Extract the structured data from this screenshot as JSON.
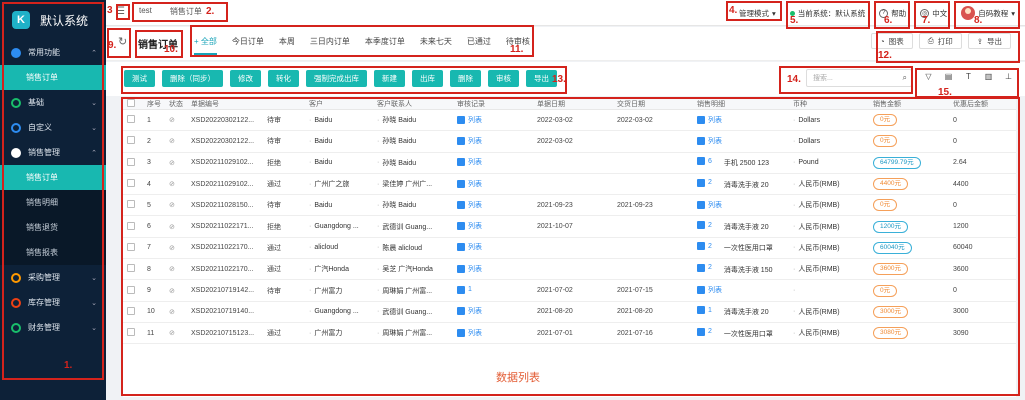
{
  "sidebar": {
    "title": "默认系统",
    "groups": [
      {
        "label": "常用功能",
        "color": "#2d8cf0",
        "items": [
          "销售订单"
        ]
      },
      {
        "label": "基础",
        "color": "#19be6b",
        "items": []
      },
      {
        "label": "自定义",
        "color": "#2d8cf0",
        "items": []
      },
      {
        "label": "销售管理",
        "color": "#ffffff",
        "items": [
          "销售订单",
          "销售明细",
          "销售退货",
          "销售报表"
        ]
      },
      {
        "label": "采购管理",
        "color": "#ff9900",
        "items": []
      },
      {
        "label": "库存管理",
        "color": "#ed4014",
        "items": []
      },
      {
        "label": "财务管理",
        "color": "#19be6b",
        "items": []
      }
    ]
  },
  "topbar": {
    "breadcrumb": [
      "test",
      "销售订单"
    ],
    "mode": "管理模式",
    "current_system": "当前系统：默认系统",
    "help": "帮助",
    "lang": "中文",
    "user": "自码教程"
  },
  "page": {
    "title": "销售订单",
    "tabs": [
      "全部",
      "今日订单",
      "本周",
      "三日内订单",
      "本季度订单",
      "未来七天",
      "已通过",
      "待审核"
    ],
    "right_buttons": [
      "图表",
      "打印",
      "导出"
    ]
  },
  "toolbar": {
    "buttons": [
      "测试",
      "删除（同步）",
      "修改",
      "转化",
      "强制完成出库",
      "新建",
      "出库",
      "删除",
      "审核",
      "导出"
    ],
    "search_placeholder": "搜索..."
  },
  "table": {
    "headers": [
      "序号",
      "状态",
      "单据编号",
      "",
      "客户",
      "客户联系人",
      "审核记录",
      "单据日期",
      "交货日期",
      "销售明细",
      "币种",
      "销售金额",
      "优惠后金额"
    ],
    "rows": [
      [
        "1",
        "",
        "XSD20220302122...",
        "待审",
        "Baidu",
        "孙晓 Baidu",
        "列表",
        "2022-03-02",
        "2022-03-02",
        "列表",
        "Dollars",
        "0元",
        "0"
      ],
      [
        "2",
        "",
        "XSD20220302122...",
        "待审",
        "Baidu",
        "孙晓 Baidu",
        "列表",
        "2022-03-02",
        "",
        "列表",
        "Dollars",
        "0元",
        "0"
      ],
      [
        "3",
        "",
        "XSD20211029102...",
        "拒绝",
        "Baidu",
        "孙晓 Baidu",
        "列表",
        "",
        "",
        "6",
        "Pound",
        "64799.79元",
        "2.64"
      ],
      [
        "4",
        "",
        "XSD20211029102...",
        "通过",
        "广州广之旅",
        "梁佳婷 广州广...",
        "列表",
        "",
        "",
        "2",
        "人民币(RMB)",
        "4400元",
        "4400"
      ],
      [
        "5",
        "",
        "XSD20211028150...",
        "待审",
        "Baidu",
        "孙晓 Baidu",
        "列表",
        "2021-09-23",
        "2021-09-23",
        "列表",
        "人民币(RMB)",
        "0元",
        "0"
      ],
      [
        "6",
        "",
        "XSD20211022171...",
        "拒绝",
        "Guangdong ...",
        "武德训 Guang...",
        "列表",
        "2021-10-07",
        "",
        "2",
        "人民币(RMB)",
        "1200元",
        "1200"
      ],
      [
        "7",
        "",
        "XSD20211022170...",
        "通过",
        "alicloud",
        "陈晨 alicloud",
        "列表",
        "",
        "",
        "2",
        "人民币(RMB)",
        "60040元",
        "60040"
      ],
      [
        "8",
        "",
        "XSD20211022170...",
        "通过",
        "广汽Honda",
        "吴芝 广汽Honda",
        "列表",
        "",
        "",
        "2",
        "人民币(RMB)",
        "3600元",
        "3600"
      ],
      [
        "9",
        "",
        "XSD20210719142...",
        "待审",
        "广州富力",
        "周琳娟 广州富...",
        "1",
        "2021-07-02",
        "2021-07-15",
        "列表",
        "",
        "0元",
        "0"
      ],
      [
        "10",
        "",
        "XSD20210719140...",
        "",
        "Guangdong ...",
        "武德训 Guang...",
        "列表",
        "2021-08-20",
        "2021-08-20",
        "1",
        "人民币(RMB)",
        "3000元",
        "3000"
      ],
      [
        "11",
        "",
        "XSD20210715123...",
        "通过",
        "广州富力",
        "周琳娟 广州富...",
        "列表",
        "2021-07-01",
        "2021-07-16",
        "2",
        "人民币(RMB)",
        "3080元",
        "3090"
      ]
    ],
    "detail_text": [
      "",
      "",
      "手机 2500 123",
      "消毒洗手液 20",
      "",
      "消毒洗手液 20",
      "一次性医用口罩",
      "消毒洗手液 150",
      "",
      "消毒洗手液 20",
      "一次性医用口罩"
    ],
    "blue_pills": [
      "64799.79元",
      "1200元",
      "60040元"
    ],
    "empty_caption": "数据列表"
  },
  "annotations": [
    "1.",
    "2.",
    "3",
    "4.",
    "5.",
    "6.",
    "7.",
    "8.",
    "9.",
    "10.",
    "11.",
    "12.",
    "13.",
    "14.",
    "15."
  ]
}
